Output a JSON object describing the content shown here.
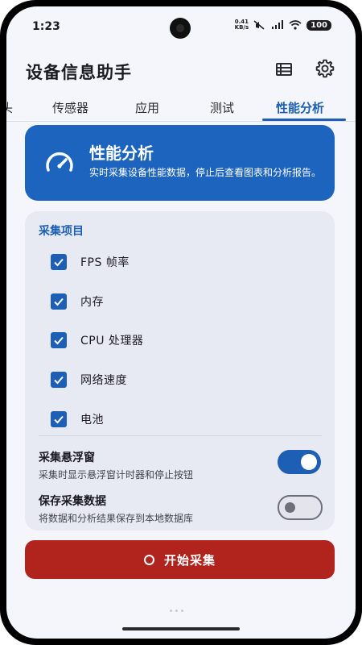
{
  "status_bar": {
    "time": "1:23",
    "net_speed_value": "0.41",
    "net_speed_unit": "KB/s",
    "battery": "100"
  },
  "app_bar": {
    "title": "设备信息助手",
    "icons": [
      "list-icon",
      "gear-icon"
    ]
  },
  "tabs": {
    "items": [
      {
        "label": "头"
      },
      {
        "label": "传感器"
      },
      {
        "label": "应用"
      },
      {
        "label": "测试"
      },
      {
        "label": "性能分析"
      }
    ],
    "active": "性能分析"
  },
  "hero": {
    "icon": "speedometer-icon",
    "title": "性能分析",
    "description": "实时采集设备性能数据，停止后查看图表和分析报告。"
  },
  "collect": {
    "section_label": "采集项目",
    "items": [
      {
        "label": "FPS 帧率",
        "checked": true
      },
      {
        "label": "内存",
        "checked": true
      },
      {
        "label": "CPU 处理器",
        "checked": true
      },
      {
        "label": "网络速度",
        "checked": true
      },
      {
        "label": "电池",
        "checked": true
      }
    ],
    "floating_window": {
      "title": "采集悬浮窗",
      "description": "采集时显示悬浮窗计时器和停止按钮",
      "enabled": true
    },
    "save_data": {
      "title": "保存采集数据",
      "description": "将数据和分析结果保存到本地数据库",
      "enabled": false
    }
  },
  "start_button": {
    "label": "开始采集"
  },
  "colors": {
    "primary": "#1c5fb5",
    "hero_bg": "#1d64bf",
    "start_button": "#b0241d",
    "panel_bg": "#e8eaf3"
  }
}
